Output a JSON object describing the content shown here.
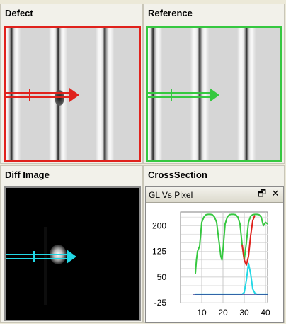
{
  "panels": {
    "defect_title": "Defect",
    "reference_title": "Reference",
    "diff_title": "Diff Image",
    "crosssection_title": "CrossSection"
  },
  "crosssection_window": {
    "title": "GL Vs Pixel",
    "restore_icon": "restore-icon",
    "close_icon": "close-icon"
  },
  "colors": {
    "defect_frame": "#e0221c",
    "reference_frame": "#36c840",
    "defect_series": "#e0221c",
    "reference_series": "#36c840",
    "diff_series": "#22d8e6",
    "baseline": "#1a1a80"
  },
  "chart_data": {
    "type": "line",
    "title": "GL Vs Pixel",
    "xlabel": "",
    "ylabel": "",
    "xlim": [
      0,
      41
    ],
    "ylim": [
      -25,
      240
    ],
    "x_ticks": [
      "10",
      "20",
      "30",
      "40"
    ],
    "y_ticks": [
      "200",
      "125",
      "50",
      "-25"
    ],
    "grid": true,
    "series": [
      {
        "color": "#36c840",
        "x": [
          7,
          7.5,
          8,
          9,
          10,
          11,
          12,
          13,
          14,
          15,
          16,
          17,
          18,
          19,
          19.5,
          20,
          21,
          22,
          23,
          24,
          25,
          26,
          27,
          28,
          29,
          30,
          31,
          32,
          33,
          34,
          35,
          36,
          37,
          38,
          39,
          40,
          41
        ],
        "y": [
          60,
          100,
          125,
          140,
          210,
          225,
          232,
          233,
          233,
          232,
          225,
          210,
          160,
          110,
          100,
          130,
          205,
          225,
          232,
          233,
          233,
          232,
          225,
          205,
          145,
          100,
          150,
          210,
          228,
          232,
          233,
          233,
          232,
          225,
          200,
          210,
          205
        ]
      },
      {
        "color": "#e0221c",
        "x": [
          29,
          30,
          31,
          32,
          33,
          34,
          35
        ],
        "y": [
          145,
          100,
          85,
          110,
          170,
          215,
          230
        ]
      },
      {
        "color": "#22d8e6",
        "x": [
          7,
          28,
          29,
          30,
          31,
          32,
          33,
          34,
          35,
          36,
          41
        ],
        "y": [
          0,
          0,
          0,
          5,
          40,
          90,
          60,
          15,
          3,
          0,
          0
        ]
      },
      {
        "color": "#1a1a80",
        "x": [
          6,
          41
        ],
        "y": [
          0,
          0
        ]
      }
    ]
  }
}
